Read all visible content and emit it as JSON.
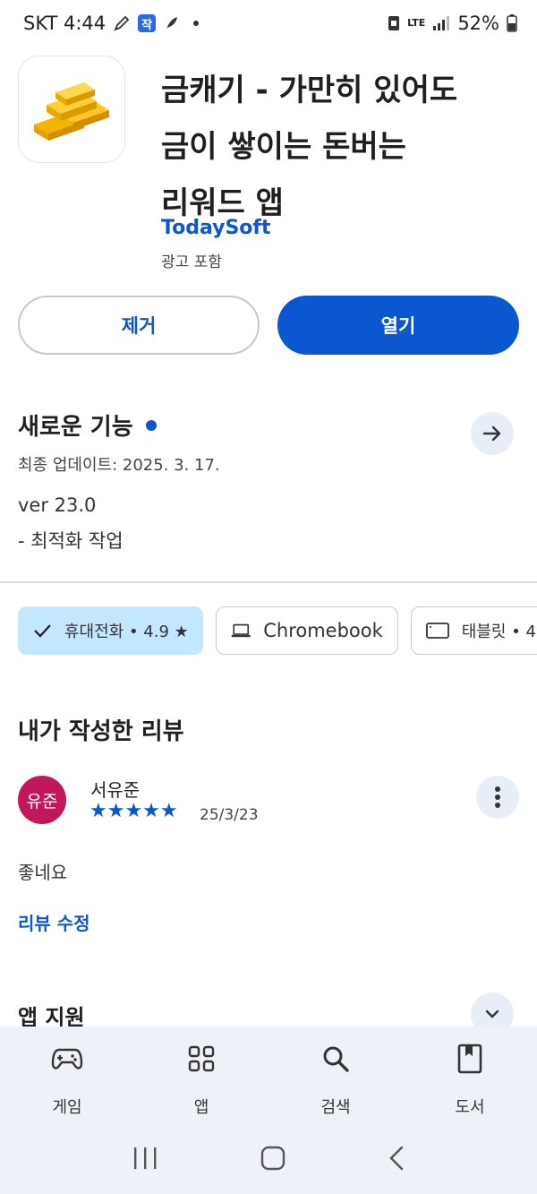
{
  "status_bar": {
    "carrier_time": "SKT 4:44",
    "badge": "작",
    "network": "LTE",
    "battery": "52%"
  },
  "app": {
    "title_line1": "금캐기 - 가만히 있어도",
    "title_line2": "금이 쌓이는 돈버는",
    "title_line3": "리워드 앱",
    "developer": "TodaySoft",
    "ads_label": "광고 포함"
  },
  "actions": {
    "uninstall_label": "제거",
    "open_label": "열기"
  },
  "whats_new": {
    "title": "새로운 기능",
    "last_updated": "최종 업데이트: 2025. 3. 17.",
    "version": "ver 23.0",
    "notes": "- 최적화 작업"
  },
  "device_chips": [
    {
      "label": "휴대전화 • 4.9 ★",
      "selected": true
    },
    {
      "label": "Chromebook",
      "selected": false
    },
    {
      "label": "태블릿 • 4",
      "selected": false
    }
  ],
  "my_review": {
    "title": "내가 작성한 리뷰",
    "avatar_text": "유준",
    "reviewer": "서유준",
    "rating": 5,
    "stars": "★★★★★",
    "date": "25/3/23",
    "text": "좋네요",
    "edit_label": "리뷰 수정"
  },
  "app_support": {
    "title": "앱 지원"
  },
  "bottom_nav": [
    {
      "label": "게임",
      "icon": "gamepad-icon"
    },
    {
      "label": "앱",
      "icon": "apps-grid-icon"
    },
    {
      "label": "검색",
      "icon": "search-icon"
    },
    {
      "label": "도서",
      "icon": "book-icon"
    }
  ],
  "colors": {
    "accent": "#0b57d0",
    "chip_selected": "#c2e7ff",
    "avatar": "#c2185b",
    "nav_bg": "#eef2f8"
  }
}
